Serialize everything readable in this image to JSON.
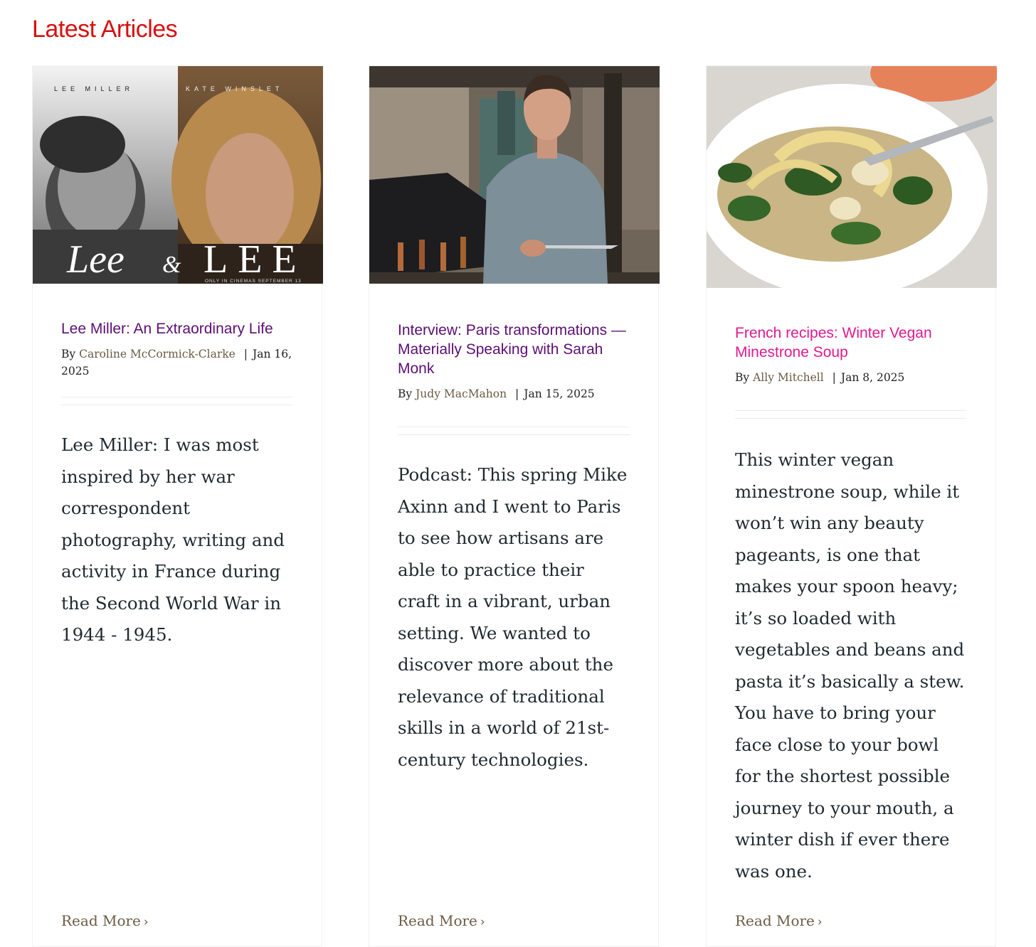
{
  "section": {
    "title": "Latest Articles"
  },
  "articles": [
    {
      "title": "Lee Miller: An Extraordinary Life",
      "by_label": "By",
      "author": "Caroline McCormick-Clarke",
      "date": "Jan 16, 2025",
      "excerpt": "Lee Miller: I was most inspired by her war correspondent photography, writing and activity in France during the Second World War in 1944 - 1945.",
      "read_more": "Read More",
      "image": {
        "top_left": "LEE MILLER",
        "top_right": "KATE WINSLET",
        "title_left": "Lee",
        "title_amp": "&",
        "title_right": "LEE",
        "tagline": "ONLY IN CINEMAS SEPTEMBER 13"
      }
    },
    {
      "title": "Interview: Paris transformations — Materially Speaking with Sarah Monk",
      "by_label": "By",
      "author": "Judy MacMahon",
      "date": "Jan 15, 2025",
      "excerpt": "Podcast: This spring Mike Axinn and I went to Paris to see how artisans are able to practice their craft in a vibrant, urban setting. We wanted to discover more about the relevance of traditional skills in a world of 21st-century technologies.",
      "read_more": "Read More"
    },
    {
      "title": "French recipes: Winter Vegan Minestrone Soup",
      "by_label": "By",
      "author": "Ally Mitchell",
      "date": "Jan 8, 2025",
      "excerpt": "This winter vegan minestrone soup, while it won’t win any beauty pageants, is one that makes your spoon heavy; it’s so loaded with vegetables and beans and pasta it’s basically a stew. You have to bring your face close to your bowl for the shortest possible journey to your mouth, a winter dish if ever there was one.",
      "read_more": "Read More"
    }
  ],
  "colors": {
    "section_title": "#d80f0f",
    "post_title": "#5c0f73",
    "post_title_active": "#e0198f",
    "author": "#6b5b43",
    "body_text": "#1f2a30"
  },
  "icons": {
    "read_more": "chevron-right-icon"
  }
}
